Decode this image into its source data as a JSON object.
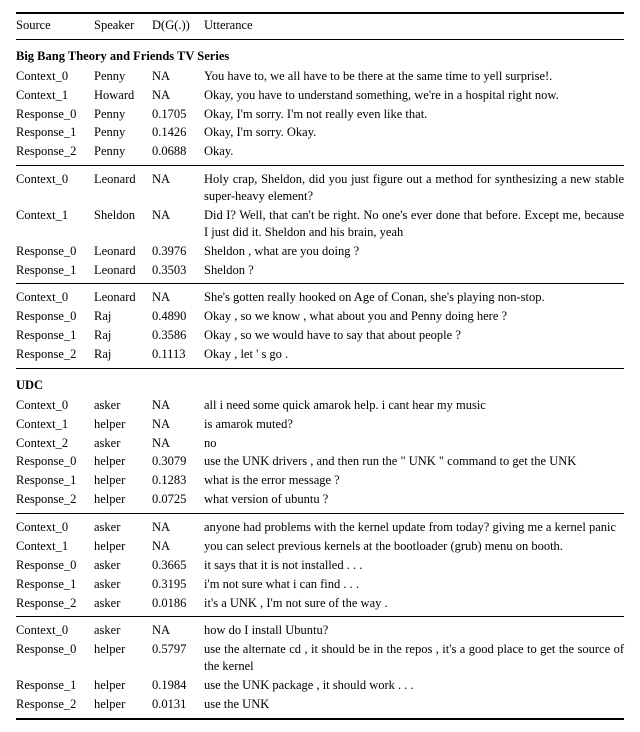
{
  "headers": {
    "source": "Source",
    "speaker": "Speaker",
    "dg": "D(G(.))",
    "utterance": "Utterance"
  },
  "sections": [
    {
      "title": "Big Bang Theory and Friends TV Series",
      "groups": [
        {
          "rows": [
            {
              "source": "Context_0",
              "speaker": "Penny",
              "dg": "NA",
              "utterance": "You have to, we all have to be there at the same time to yell surprise!."
            },
            {
              "source": "Context_1",
              "speaker": "Howard",
              "dg": "NA",
              "utterance": "Okay, you have to understand something, we're in a hospital right now."
            },
            {
              "source": "Response_0",
              "speaker": "Penny",
              "dg": "0.1705",
              "utterance": "Okay, I'm sorry. I'm not really even like that."
            },
            {
              "source": "Response_1",
              "speaker": "Penny",
              "dg": "0.1426",
              "utterance": "Okay, I'm sorry. Okay."
            },
            {
              "source": "Response_2",
              "speaker": "Penny",
              "dg": "0.0688",
              "utterance": "Okay."
            }
          ]
        },
        {
          "rows": [
            {
              "source": "Context_0",
              "speaker": "Leonard",
              "dg": "NA",
              "utterance": "Holy crap, Sheldon, did you just figure out a method for synthesizing a new stable super-heavy element?"
            },
            {
              "source": "Context_1",
              "speaker": "Sheldon",
              "dg": "NA",
              "utterance": "Did I? Well, that can't be right. No one's ever done that before. Except me, because I just did it. Sheldon and his brain, yeah"
            },
            {
              "source": "Response_0",
              "speaker": "Leonard",
              "dg": "0.3976",
              "utterance": "Sheldon , what are you doing ?"
            },
            {
              "source": "Response_1",
              "speaker": "Leonard",
              "dg": "0.3503",
              "utterance": "Sheldon ?"
            }
          ]
        },
        {
          "rows": [
            {
              "source": "Context_0",
              "speaker": "Leonard",
              "dg": "NA",
              "utterance": "She's gotten really hooked on Age of Conan, she's playing non-stop."
            },
            {
              "source": "Response_0",
              "speaker": "Raj",
              "dg": "0.4890",
              "utterance": "Okay , so we know , what about you and Penny doing here ?"
            },
            {
              "source": "Response_1",
              "speaker": "Raj",
              "dg": "0.3586",
              "utterance": "Okay , so we would have to say that about people ?"
            },
            {
              "source": "Response_2",
              "speaker": "Raj",
              "dg": "0.1113",
              "utterance": "Okay , let ' s go ."
            }
          ]
        }
      ]
    },
    {
      "title": "UDC",
      "groups": [
        {
          "rows": [
            {
              "source": "Context_0",
              "speaker": "asker",
              "dg": "NA",
              "utterance": "all i need some quick amarok help. i cant hear my music"
            },
            {
              "source": "Context_1",
              "speaker": "helper",
              "dg": "NA",
              "utterance": "is amarok muted?"
            },
            {
              "source": "Context_2",
              "speaker": "asker",
              "dg": "NA",
              "utterance": "no"
            },
            {
              "source": "Response_0",
              "speaker": "helper",
              "dg": "0.3079",
              "utterance": "use the UNK drivers , and then run the \" UNK \" command to get the UNK"
            },
            {
              "source": "Response_1",
              "speaker": "helper",
              "dg": "0.1283",
              "utterance": "what is the error message ?"
            },
            {
              "source": "Response_2",
              "speaker": "helper",
              "dg": "0.0725",
              "utterance": "what version of ubuntu ?"
            }
          ]
        },
        {
          "rows": [
            {
              "source": "Context_0",
              "speaker": "asker",
              "dg": "NA",
              "utterance": "anyone had problems with the kernel update from today? giving me a kernel panic"
            },
            {
              "source": "Context_1",
              "speaker": "helper",
              "dg": "NA",
              "utterance": "you can select previous kernels at the bootloader (grub) menu on booth."
            },
            {
              "source": "Response_0",
              "speaker": "asker",
              "dg": "0.3665",
              "utterance": "it says that it is not installed . . ."
            },
            {
              "source": "Response_1",
              "speaker": "asker",
              "dg": "0.3195",
              "utterance": "i'm not sure what i can find . . ."
            },
            {
              "source": "Response_2",
              "speaker": "asker",
              "dg": "0.0186",
              "utterance": "it's a UNK , I'm not sure of the way ."
            }
          ]
        },
        {
          "rows": [
            {
              "source": "Context_0",
              "speaker": "asker",
              "dg": "NA",
              "utterance": "how do I install Ubuntu?"
            },
            {
              "source": "Response_0",
              "speaker": "helper",
              "dg": "0.5797",
              "utterance": "use the alternate cd , it should be in the repos , it's a good place to get the source of the kernel"
            },
            {
              "source": "Response_1",
              "speaker": "helper",
              "dg": "0.1984",
              "utterance": "use the UNK package , it should work . . ."
            },
            {
              "source": "Response_2",
              "speaker": "helper",
              "dg": "0.0131",
              "utterance": "use the UNK"
            }
          ]
        }
      ]
    }
  ]
}
